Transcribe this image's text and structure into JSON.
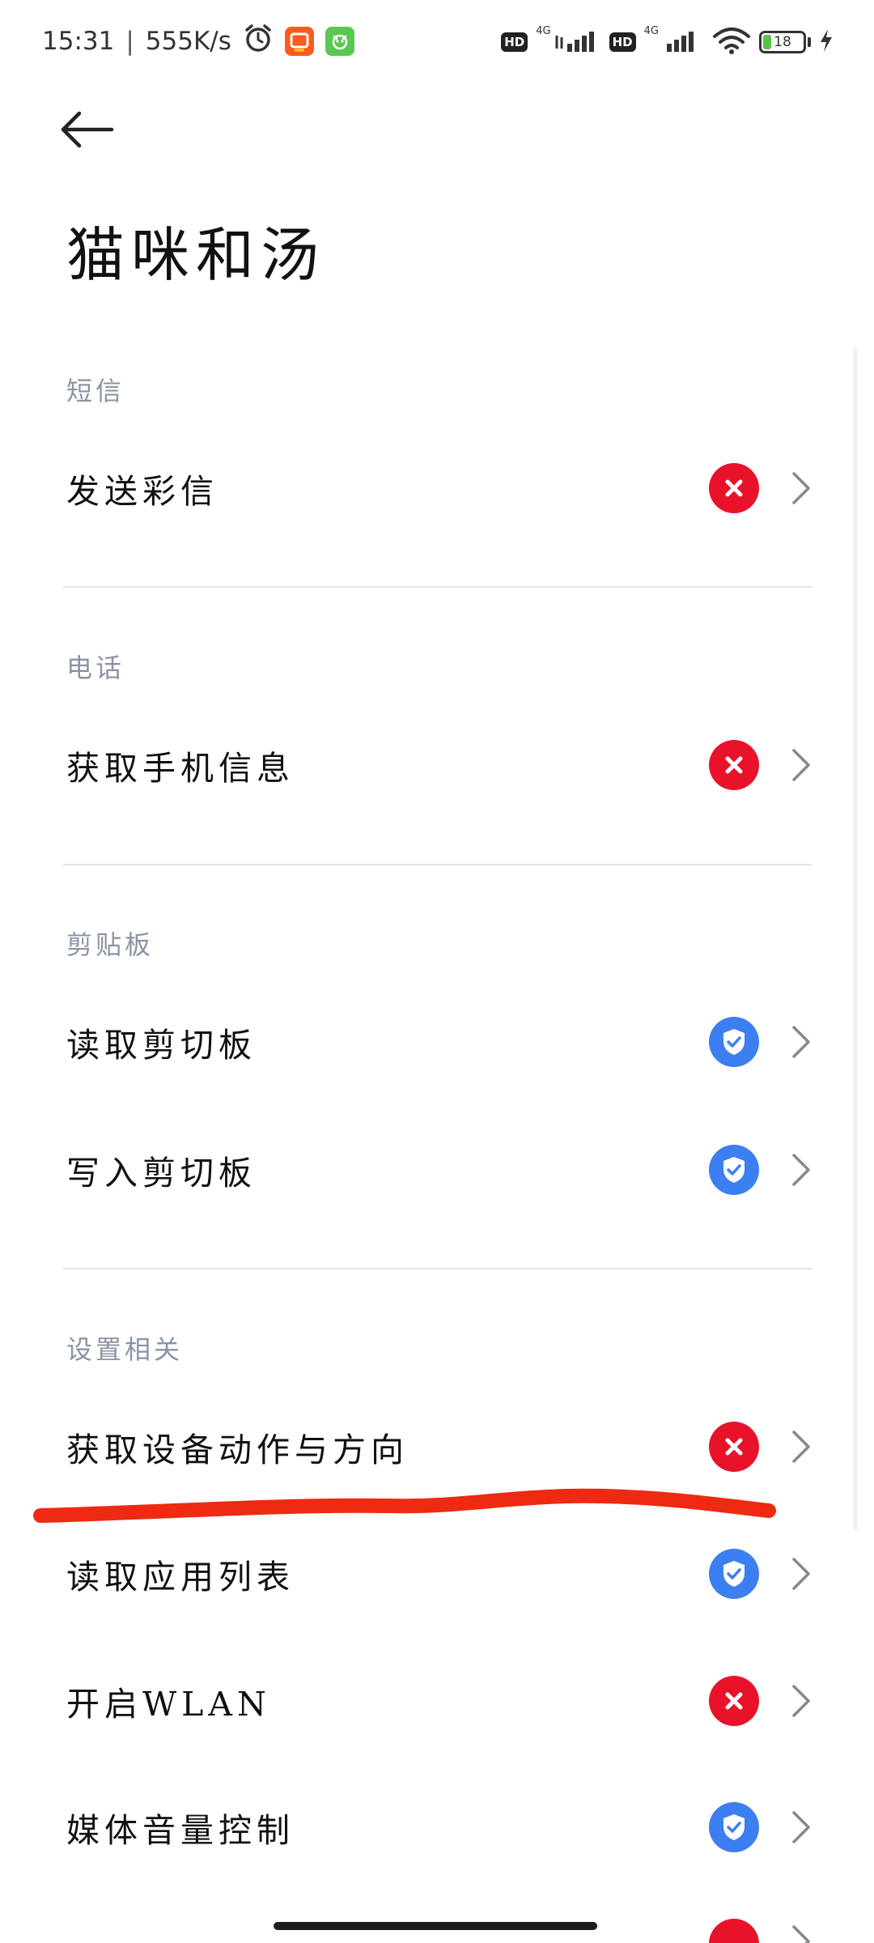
{
  "status_bar": {
    "time": "15:31",
    "separator": "|",
    "net_speed": "555K/s",
    "net_type_1": "4G",
    "net_type_2": "4G",
    "hd_1": "HD",
    "hd_2": "HD",
    "battery": "18",
    "icons": [
      "alarm-icon",
      "taobao-app-icon",
      "green-app-icon",
      "signal-icon",
      "wifi-icon",
      "battery-icon",
      "charging-icon"
    ]
  },
  "header": {
    "title": "猫咪和汤"
  },
  "sections": [
    {
      "label": "短信",
      "items": [
        {
          "label": "发送彩信",
          "status": "denied"
        }
      ]
    },
    {
      "label": "电话",
      "items": [
        {
          "label": "获取手机信息",
          "status": "denied"
        }
      ]
    },
    {
      "label": "剪贴板",
      "items": [
        {
          "label": "读取剪切板",
          "status": "allowed"
        },
        {
          "label": "写入剪切板",
          "status": "allowed"
        }
      ]
    },
    {
      "label": "设置相关",
      "items": [
        {
          "label": "获取设备动作与方向",
          "status": "denied"
        },
        {
          "label": "读取应用列表",
          "status": "allowed"
        },
        {
          "label": "开启WLAN",
          "status": "denied"
        },
        {
          "label": "媒体音量控制",
          "status": "allowed"
        }
      ]
    }
  ],
  "colors": {
    "denied": "#e8132a",
    "allowed": "#3b7ff0",
    "annotation": "#ee2a12",
    "section_label": "#8a93a3"
  }
}
